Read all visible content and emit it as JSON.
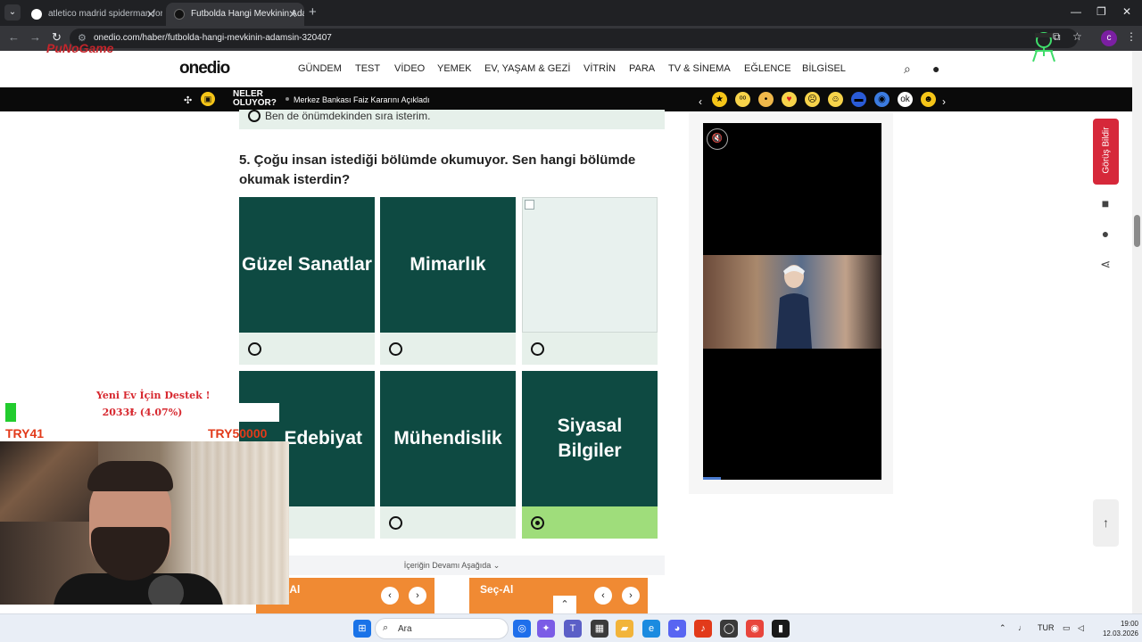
{
  "browser": {
    "tabs": [
      {
        "title": "atletico madrid spiderman form",
        "active": false
      },
      {
        "title": "Futbolda Hangi Mevkinin Adam",
        "active": true
      }
    ],
    "url": "onedio.com/haber/futbolda-hangi-mevkinin-adamsin-320407",
    "profile_initial": "c"
  },
  "header": {
    "logo": "onedio",
    "nav": [
      "GÜNDEM",
      "TEST",
      "VİDEO",
      "YEMEK",
      "EV, YAŞAM & GEZİ",
      "VİTRİN",
      "PARA",
      "TV & SİNEMA",
      "EĞLENCE",
      "BİLGİSEL"
    ]
  },
  "ticker": {
    "label_line1": "NELER",
    "label_line2": "OLUYOR?",
    "headline": "Merkez Bankası Faiz Kararını Açıkladı"
  },
  "previous_answer": "Ben de önümdekinden sıra isterim.",
  "question": {
    "number": "5.",
    "text": "5. Çoğu insan istediği bölümde okumuyor. Sen hangi bölümde okumak isterdin?",
    "options": [
      {
        "label": "Güzel Sanatlar",
        "selected": false,
        "image": true
      },
      {
        "label": "Mimarlık",
        "selected": false,
        "image": true
      },
      {
        "label": "",
        "selected": false,
        "image": false
      },
      {
        "label": "Edebiyat",
        "selected": false,
        "image": true
      },
      {
        "label": "Mühendislik",
        "selected": false,
        "image": true
      },
      {
        "label": "Siyasal Bilgiler",
        "selected": true,
        "image": true
      }
    ]
  },
  "continue_text": "İçeriğin Devamı Aşağıda",
  "ads": [
    {
      "text": "Seç-Al"
    },
    {
      "text": "Seç-Al"
    }
  ],
  "feedback_label": "Görüş Bildir",
  "overlay": {
    "logo": "PuNoGame",
    "goal_title": "Yeni Ev İçin Destek !",
    "goal_amount": "2033₺ (4.07%)",
    "goal_fraction": 0.0407,
    "goal_min": "TRY41",
    "goal_max": "TRY50000"
  },
  "taskbar": {
    "search_placeholder": "Ara",
    "language": "TUR",
    "time": "19:00",
    "date": "12.03.2026"
  },
  "colors": {
    "card_green": "#0e4a42",
    "selected_green": "#9fdd7b",
    "feedback_red": "#d6283a",
    "ad_orange": "#f08a33"
  }
}
